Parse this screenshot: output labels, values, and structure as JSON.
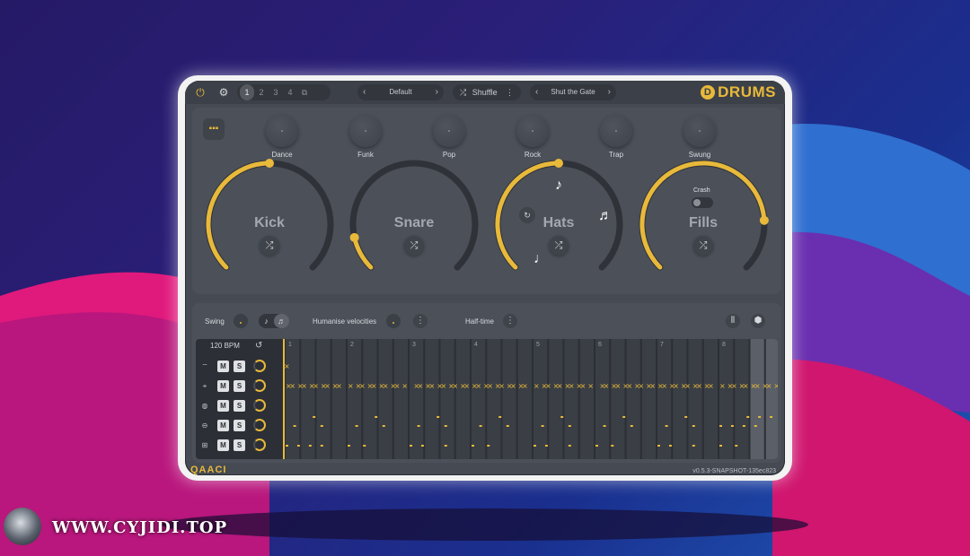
{
  "topbar": {
    "slots": [
      "1",
      "2",
      "3",
      "4"
    ],
    "active_slot": "1",
    "preset_name": "Default",
    "shuffle_label": "Shuffle",
    "song_name": "Shut the Gate",
    "logo_badge": "D",
    "logo_text": "DRUMS",
    "icons": {
      "power": "power-icon",
      "settings": "gear-icon",
      "copy": "copy-icon",
      "shuffle": "shuffle-icon",
      "more": "more-icon"
    }
  },
  "styles": [
    "Dance",
    "Funk",
    "Pop",
    "Rock",
    "Trap",
    "Swung"
  ],
  "instruments": [
    {
      "name": "Kick",
      "level": 0.5
    },
    {
      "name": "Snare",
      "level": 0.12
    },
    {
      "name": "Hats",
      "level": 0.5
    },
    {
      "name": "Fills",
      "level": 0.82
    }
  ],
  "fills": {
    "crash_label": "Crash"
  },
  "controls": {
    "swing_label": "Swing",
    "humanise_label": "Humanise velocities",
    "halftime_label": "Half-time"
  },
  "sequencer": {
    "bpm": "120 BPM",
    "bar_numbers": [
      "1",
      "2",
      "3",
      "4",
      "5",
      "6",
      "7",
      "8"
    ],
    "rows": [
      {
        "icon": "cymbal-icon",
        "mute": "M",
        "solo": "S"
      },
      {
        "icon": "hihat-icon",
        "mute": "M",
        "solo": "S"
      },
      {
        "icon": "tom-icon",
        "mute": "M",
        "solo": "S"
      },
      {
        "icon": "snare-icon",
        "mute": "M",
        "solo": "S"
      },
      {
        "icon": "kick-icon",
        "mute": "M",
        "solo": "S"
      }
    ]
  },
  "footer": {
    "brand": "QAACI",
    "version": "v0.5.3-SNAPSHOT-135ec823"
  },
  "watermark": {
    "text": "WWW.CYJIDI.TOP"
  },
  "colors": {
    "accent": "#e8b93a",
    "panel": "#4b5059",
    "track": "#2f3238"
  }
}
